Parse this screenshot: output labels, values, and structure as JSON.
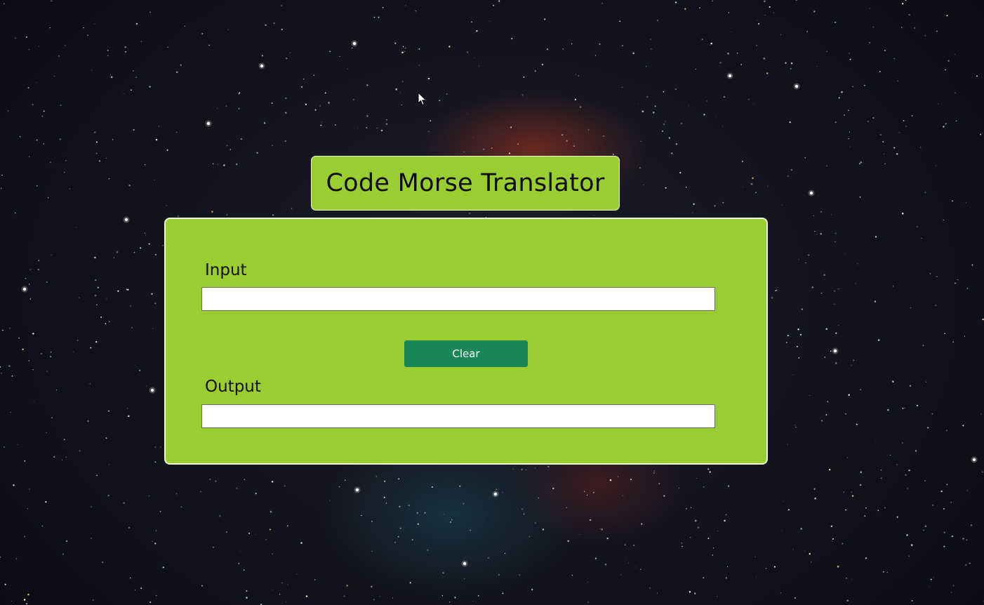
{
  "app": {
    "title": "Code Morse Translator"
  },
  "input": {
    "label": "Input",
    "value": "",
    "placeholder": ""
  },
  "clear_button": {
    "label": "Clear"
  },
  "output": {
    "label": "Output",
    "value": "",
    "placeholder": ""
  },
  "colors": {
    "panel_background": "#9acd32",
    "button_background": "#198754",
    "page_background": "#15161f"
  }
}
